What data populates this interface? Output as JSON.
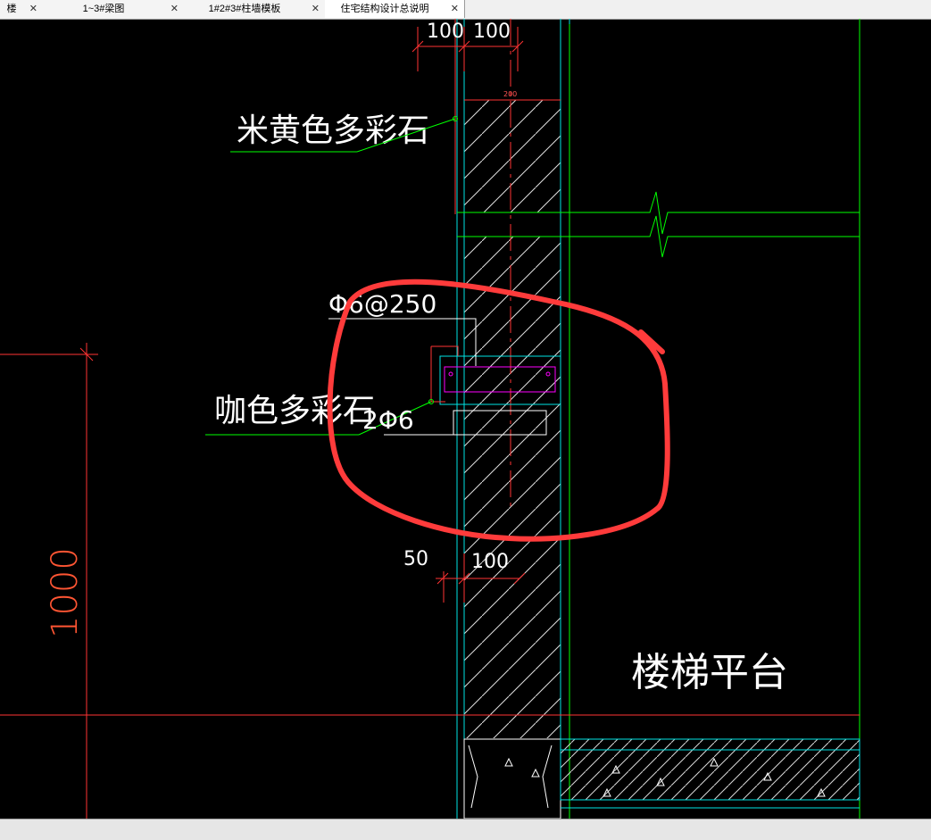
{
  "tabs": [
    {
      "label": "楼",
      "close": "✕"
    },
    {
      "label": "1~3#梁图",
      "close": "✕"
    },
    {
      "label": "1#2#3#柱墙模板",
      "close": "✕"
    },
    {
      "label": "住宅结构设计总说明",
      "close": "✕"
    }
  ],
  "drawing": {
    "dims": {
      "top_left": "100",
      "top_right": "100",
      "wall_200": "200",
      "bottom_50": "50",
      "bottom_100": "100",
      "height_1000": "1000"
    },
    "labels": {
      "beige_stone": "米黄色多彩石",
      "coffee_stone": "咖色多彩石",
      "rebar_spacing": "Φ6@250",
      "rebar_count": "2Φ6",
      "stair_platform": "楼梯平台"
    },
    "colors": {
      "background": "#000000",
      "wall_line": "#00ffff",
      "leader": "#00ff00",
      "dimension": "#ff3333",
      "rebar": "#ff00ff",
      "text": "#ffffff",
      "annotation": "#ff3b3b"
    }
  }
}
